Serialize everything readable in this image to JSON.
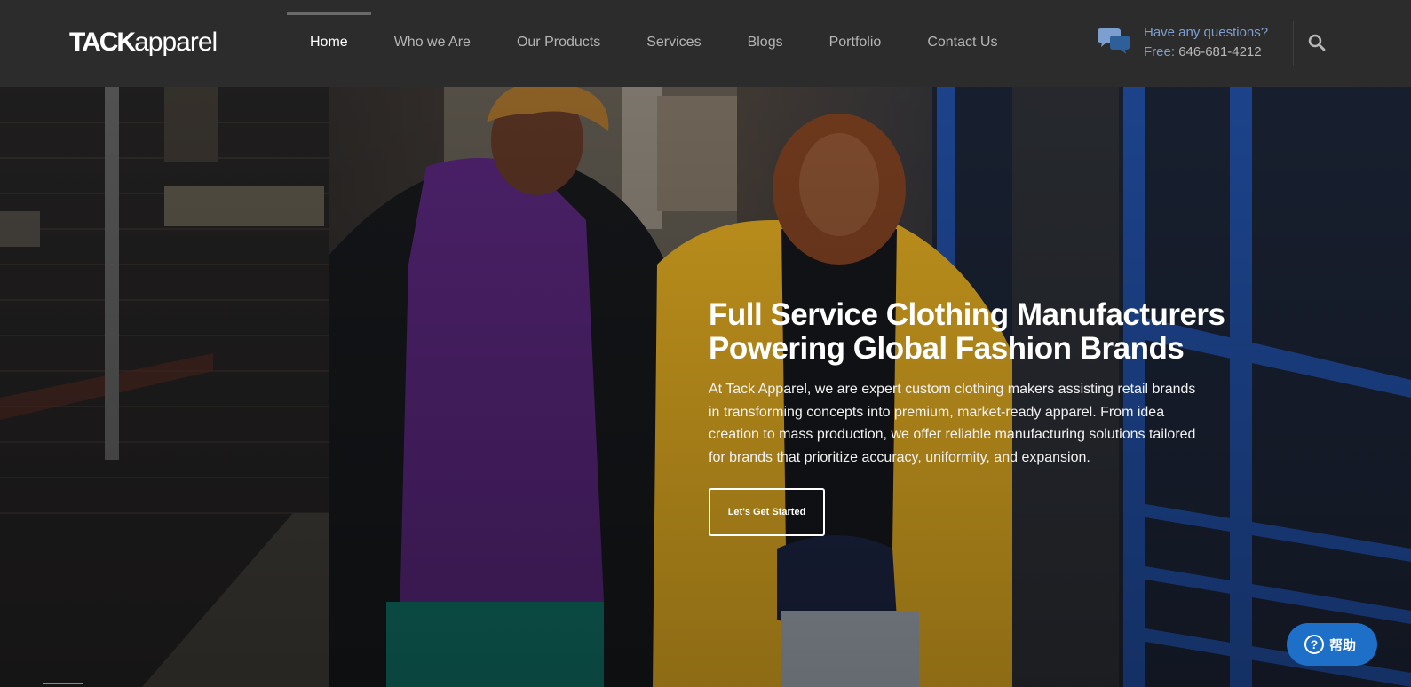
{
  "header": {
    "logo": {
      "bold": "TACK",
      "light": "apparel"
    },
    "nav": [
      {
        "label": "Home",
        "active": true
      },
      {
        "label": "Who we Are",
        "active": false
      },
      {
        "label": "Our Products",
        "active": false
      },
      {
        "label": "Services",
        "active": false
      },
      {
        "label": "Blogs",
        "active": false
      },
      {
        "label": "Portfolio",
        "active": false
      },
      {
        "label": "Contact Us",
        "active": false
      }
    ],
    "contact": {
      "question": "Have any questions?",
      "free_label": "Free:",
      "phone": "646-681-4212",
      "icon": "chat-bubbles-icon"
    },
    "search_icon": "search-icon"
  },
  "hero": {
    "title_line1": "Full Service Clothing Manufacturers",
    "title_line2": "Powering Global Fashion Brands",
    "description": "At Tack Apparel, we are expert custom clothing makers assisting retail brands in transforming concepts into premium, market-ready apparel. From idea creation to mass production, we offer reliable manufacturing solutions tailored for brands that prioritize accuracy, uniformity, and expansion.",
    "cta_label": "Let's Get Started"
  },
  "help": {
    "label": "帮助",
    "icon": "question-circle-icon"
  },
  "colors": {
    "header_bg": "#2c2c2c",
    "accent_blue": "#7d9fd0",
    "help_blue": "#1d6fc7",
    "coat_yellow": "#d9a520",
    "hoodie_purple": "#5a2a78"
  }
}
